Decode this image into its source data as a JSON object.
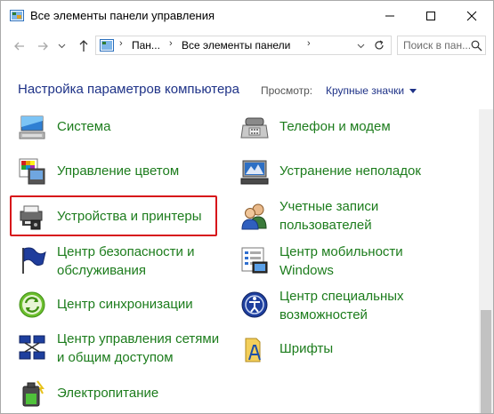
{
  "window": {
    "title": "Все элементы панели управления",
    "controls": {
      "minimize": "minimize-icon",
      "maximize": "maximize-icon",
      "close": "close-icon"
    }
  },
  "address": {
    "crumbs": [
      "Пан...",
      "Все элементы панели",
      ""
    ],
    "search_placeholder": "Поиск в пан...",
    "buttons": [
      "back-arrow-icon",
      "forward-arrow-icon",
      "recent-dropdown-icon",
      "up-arrow-icon",
      "address-dropdown-icon",
      "refresh-icon",
      "search-icon"
    ]
  },
  "header": {
    "title": "Настройка параметров компьютера",
    "view_label": "Просмотр:",
    "view_value": "Крупные значки"
  },
  "items": {
    "left": [
      {
        "label": "Система",
        "icon": "system-icon"
      },
      {
        "label": "Управление цветом",
        "icon": "color-management-icon"
      },
      {
        "label": "Устройства и принтеры",
        "icon": "devices-printers-icon"
      },
      {
        "label1": "Центр безопасности и",
        "label2": "обслуживания",
        "icon": "security-flag-icon"
      },
      {
        "label": "Центр синхронизации",
        "icon": "sync-center-icon"
      },
      {
        "label1": "Центр управления сетями",
        "label2": "и общим доступом",
        "icon": "network-center-icon"
      },
      {
        "label": "Электропитание",
        "icon": "power-options-icon"
      }
    ],
    "right": [
      {
        "label": "Телефон и модем",
        "icon": "phone-modem-icon"
      },
      {
        "label": "Устранение неполадок",
        "icon": "troubleshooting-icon"
      },
      {
        "label1": "Учетные записи",
        "label2": "пользователей",
        "icon": "user-accounts-icon"
      },
      {
        "label1": "Центр мобильности",
        "label2": "Windows",
        "icon": "mobility-center-icon"
      },
      {
        "label1": "Центр специальных",
        "label2": "возможностей",
        "icon": "ease-of-access-icon"
      },
      {
        "label": "Шрифты",
        "icon": "fonts-icon"
      }
    ]
  },
  "colors": {
    "link_green": "#1c7c1c",
    "heading_blue": "#1e3287",
    "highlight_red": "#d7141a"
  }
}
